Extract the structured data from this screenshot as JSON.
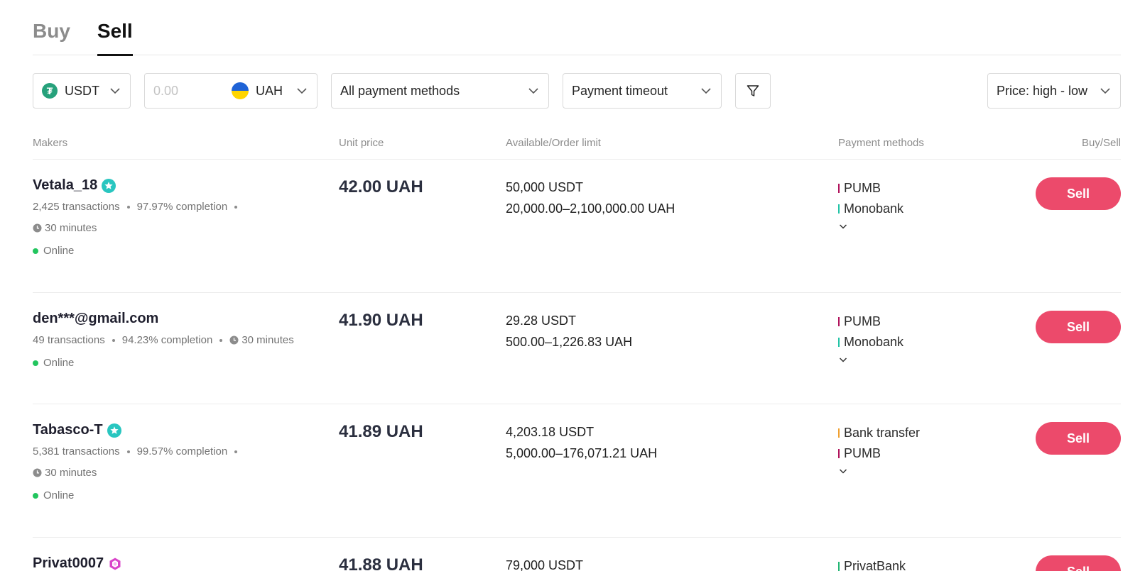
{
  "tabs": [
    {
      "label": "Buy",
      "active": false
    },
    {
      "label": "Sell",
      "active": true
    }
  ],
  "filters": {
    "crypto": {
      "value": "USDT",
      "icon": "tether-icon",
      "color": "#26a17b"
    },
    "amount": {
      "placeholder": "0.00"
    },
    "fiat": {
      "value": "UAH",
      "icon": "ukraine-flag-icon"
    },
    "payment_methods": {
      "value": "All payment methods"
    },
    "payment_timeout": {
      "value": "Payment timeout"
    },
    "filter_icon": "filter-icon",
    "sort": {
      "value": "Price: high - low"
    }
  },
  "table_headers": {
    "makers": "Makers",
    "unit_price": "Unit price",
    "available": "Available/Order limit",
    "payment_methods": "Payment methods",
    "action": "Buy/Sell"
  },
  "colors": {
    "sell_button": "#ec4a6b",
    "online": "#22c55e",
    "pumb": "#b0125a",
    "monobank": "#22c3a6",
    "bank_transfer": "#f0a030",
    "privatbank": "#22b573"
  },
  "rows": [
    {
      "name": "Vetala_18",
      "badge": "verified-star-badge-icon",
      "transactions": "2,425 transactions",
      "completion": "97.97% completion",
      "timeout": "30 minutes",
      "status": "Online",
      "price": "42.00 UAH",
      "available": "50,000 USDT",
      "limit": "20,000.00–2,100,000.00 UAH",
      "payment_methods": [
        "PUMB",
        "Monobank"
      ],
      "action": "Sell"
    },
    {
      "name": "den***@gmail.com",
      "badge": "",
      "transactions": "49 transactions",
      "completion": "94.23% completion",
      "timeout": "30 minutes",
      "status": "Online",
      "price": "41.90 UAH",
      "available": "29.28 USDT",
      "limit": "500.00–1,226.83 UAH",
      "payment_methods": [
        "PUMB",
        "Monobank"
      ],
      "action": "Sell"
    },
    {
      "name": "Tabasco-T",
      "badge": "verified-star-badge-icon",
      "transactions": "5,381 transactions",
      "completion": "99.57% completion",
      "timeout": "30 minutes",
      "status": "Online",
      "price": "41.89 UAH",
      "available": "4,203.18 USDT",
      "limit": "5,000.00–176,071.21 UAH",
      "payment_methods": [
        "Bank transfer",
        "PUMB"
      ],
      "action": "Sell"
    },
    {
      "name": "Privat0007",
      "badge": "hexagon-badge-icon",
      "price": "41.88 UAH",
      "available": "79,000 USDT",
      "payment_methods": [
        "PrivatBank"
      ],
      "action": "Sell"
    }
  ]
}
